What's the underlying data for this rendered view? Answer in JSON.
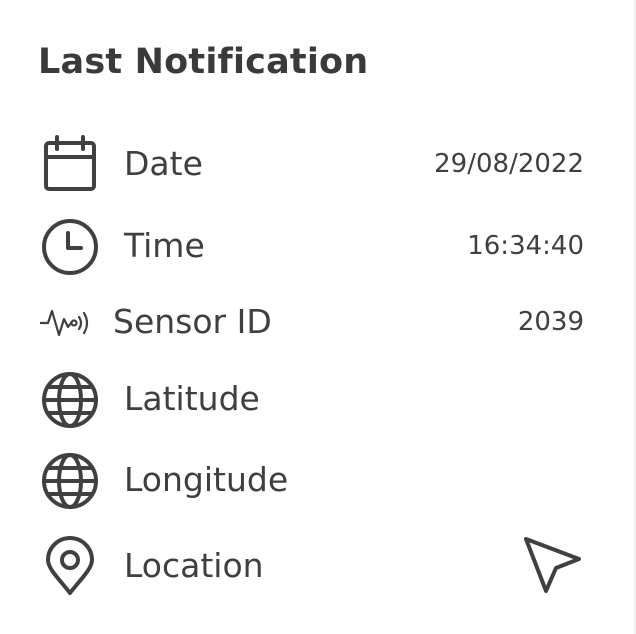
{
  "panel": {
    "title": "Last Notification"
  },
  "rows": [
    {
      "icon": "calendar-icon",
      "label": "Date",
      "value": "29/08/2022"
    },
    {
      "icon": "clock-icon",
      "label": "Time",
      "value": "16:34:40"
    },
    {
      "icon": "sensor-signal-icon",
      "label": "Sensor ID",
      "value": "2039"
    },
    {
      "icon": "globe-icon",
      "label": "Latitude",
      "value": ""
    },
    {
      "icon": "globe-icon",
      "label": "Longitude",
      "value": ""
    },
    {
      "icon": "map-pin-icon",
      "label": "Location",
      "value": ""
    }
  ],
  "location_action_icon": "navigation-arrow-icon",
  "colors": {
    "icon_stroke": "#404040",
    "text": "#3f3f3f",
    "background": "#ffffff"
  }
}
